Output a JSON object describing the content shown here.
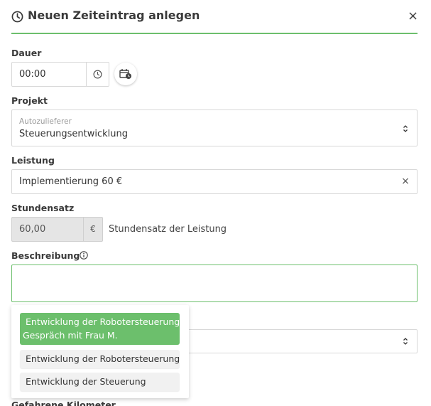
{
  "dialog": {
    "title": "Neuen Zeiteintrag anlegen",
    "close_symbol": "×",
    "icons": {
      "title": "clock-icon",
      "close": "close-icon"
    }
  },
  "dauer": {
    "label": "Dauer",
    "value": "00:00",
    "icons": {
      "timer": "clock-icon",
      "calendar": "calendar-clock-icon"
    }
  },
  "projekt": {
    "label": "Projekt",
    "customer": "Autozulieferer",
    "value": "Steuerungsentwicklung"
  },
  "leistung": {
    "label": "Leistung",
    "value": "Implementierung 60 €",
    "clear_symbol": "×"
  },
  "stundensatz": {
    "label": "Stundensatz",
    "value": "60,00",
    "unit": "€",
    "note": "Stundensatz der Leistung"
  },
  "beschreibung": {
    "label": "Beschreibung",
    "value": "",
    "icons": {
      "info": "info-icon"
    }
  },
  "suggestions": [
    {
      "line1": "Entwicklung der Robotersteuerung",
      "line2": "Gespräch mit Frau M.",
      "active": true
    },
    {
      "line1": "Entwicklung der Robotersteuerung",
      "active": false
    },
    {
      "line1": "Entwicklung der Steuerung",
      "active": false
    }
  ],
  "next_label": "Gefahrene Kilometer",
  "colors": {
    "accent": "#6cbf6c",
    "border": "#d8d8d8",
    "disabled_bg": "#e5e5e5"
  }
}
